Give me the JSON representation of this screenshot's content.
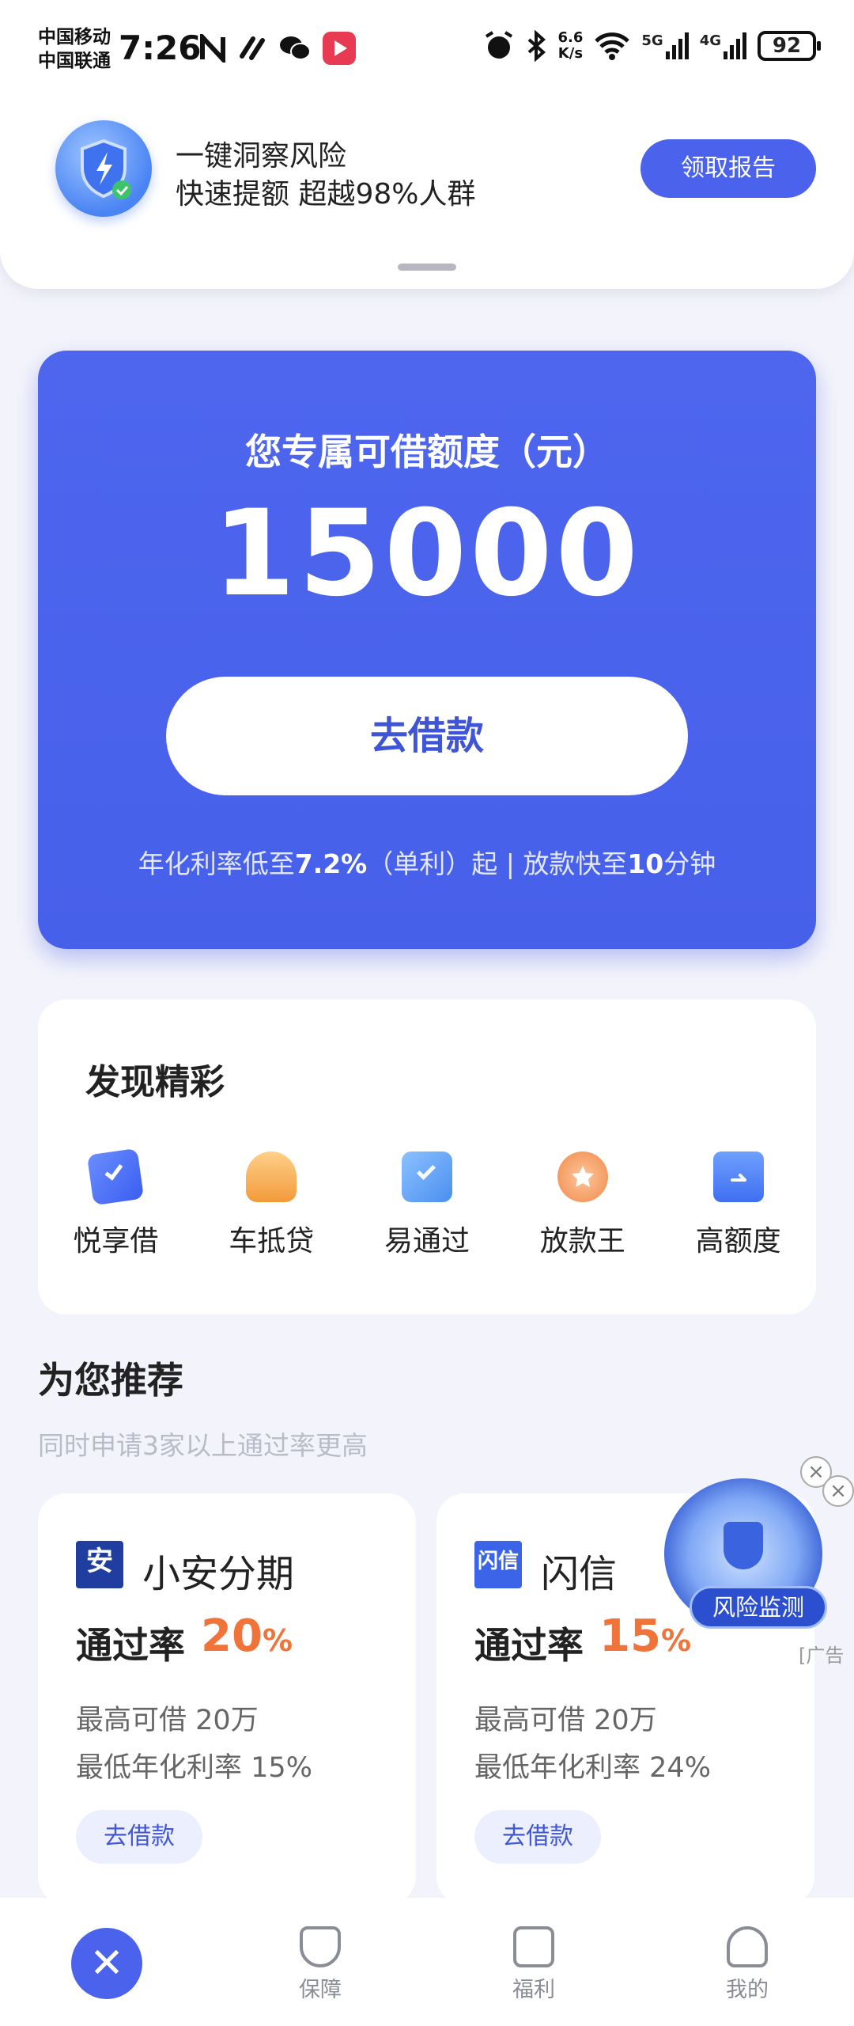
{
  "status_bar": {
    "carrier1": "中国移动",
    "carrier2": "中国联通",
    "time": "7:26",
    "speed_value": "6.6",
    "speed_unit": "K/s",
    "net1": "5G",
    "net2": "4G",
    "battery": "92"
  },
  "banner": {
    "line1": "一键洞察风险",
    "line2": "快速提额 超越98%人群",
    "button": "领取报告"
  },
  "credit": {
    "title": "您专属可借额度（元）",
    "amount": "15000",
    "button": "去借款",
    "note_part1": "年化利率低至",
    "note_rate": "7.2%",
    "note_part2": "（单利）起 | 放款快至",
    "note_time": "10",
    "note_part3": "分钟"
  },
  "discover": {
    "title": "发现精彩",
    "items": [
      {
        "label": "悦享借",
        "icon": "card-check-icon"
      },
      {
        "label": "车抵贷",
        "icon": "car-loan-icon"
      },
      {
        "label": "易通过",
        "icon": "check-doc-icon"
      },
      {
        "label": "放款王",
        "icon": "medal-icon"
      },
      {
        "label": "高额度",
        "icon": "folder-icon"
      }
    ]
  },
  "recommend": {
    "title": "为您推荐",
    "subtitle": "同时申请3家以上通过率更高",
    "cards": [
      {
        "logo": "安",
        "name": "小安分期",
        "rate_label": "通过率",
        "rate": "20",
        "rate_unit": "%",
        "max_label": "最高可借",
        "max_value": "20万",
        "min_rate_label": "最低年化利率",
        "min_rate_value": "15%",
        "button": "去借款"
      },
      {
        "logo": "闪信",
        "name": "闪信",
        "rate_label": "通过率",
        "rate": "15",
        "rate_unit": "%",
        "max_label": "最高可借",
        "max_value": "20万",
        "min_rate_label": "最低年化利率",
        "min_rate_value": "24%",
        "button": "去借款"
      }
    ]
  },
  "float_ad": {
    "label": "风险监测",
    "ad_tag": "广告"
  },
  "bottom_nav": {
    "items": [
      {
        "label": "",
        "icon": "home-logo-icon"
      },
      {
        "label": "保障",
        "icon": "shield-check-icon"
      },
      {
        "label": "福利",
        "icon": "calendar-check-icon"
      },
      {
        "label": "我的",
        "icon": "person-icon"
      }
    ]
  },
  "colors": {
    "primary": "#4b63ec",
    "accent_orange": "#f0743a",
    "page_bg": "#f3f4fb"
  }
}
